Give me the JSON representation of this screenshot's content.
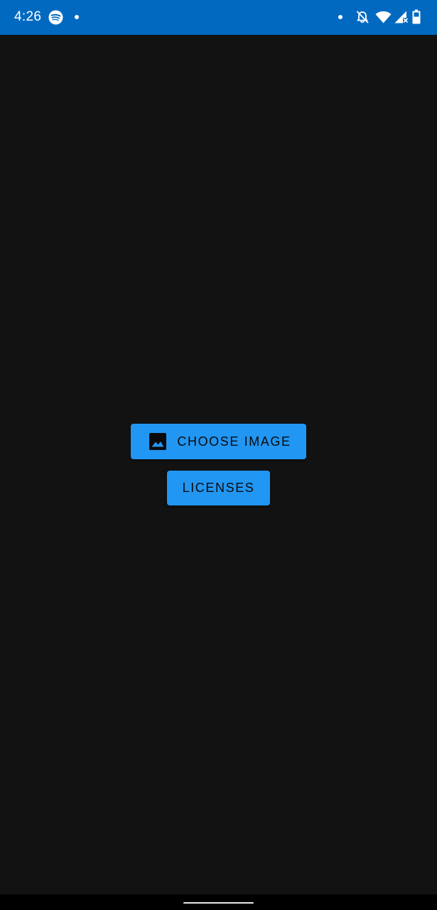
{
  "status_bar": {
    "time": "4:26",
    "background": "#016ac0",
    "icons": [
      "spotify-icon",
      "notification-dot-icon",
      "notification-dot-icon",
      "alarm-off-icon",
      "wifi-icon",
      "cellular-no-signal-icon",
      "battery-icon"
    ]
  },
  "main": {
    "background": "#121212",
    "choose_image": {
      "label": "CHOOSE IMAGE",
      "icon": "image-icon"
    },
    "licenses": {
      "label": "LICENSES"
    },
    "button_color": "#2196f3"
  },
  "nav_bar": {
    "handle": "gesture-handle"
  }
}
